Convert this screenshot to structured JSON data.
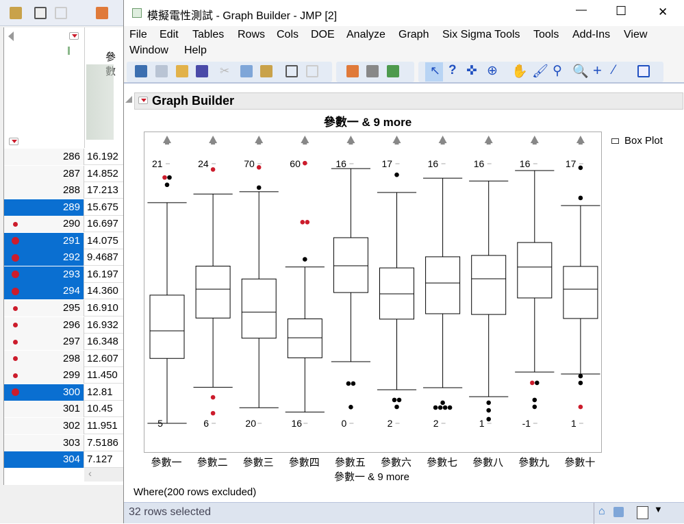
{
  "background_table": {
    "column_header": "參數",
    "rows": [
      {
        "n": "286",
        "v": "16.192",
        "sel": false,
        "marker": ""
      },
      {
        "n": "287",
        "v": "14.852",
        "sel": false,
        "marker": ""
      },
      {
        "n": "288",
        "v": "17.213",
        "sel": false,
        "marker": ""
      },
      {
        "n": "289",
        "v": "15.675",
        "sel": true,
        "marker": ""
      },
      {
        "n": "290",
        "v": "16.697",
        "sel": false,
        "marker": "small"
      },
      {
        "n": "291",
        "v": "14.075",
        "sel": true,
        "marker": "large"
      },
      {
        "n": "292",
        "v": "9.4687",
        "sel": true,
        "marker": "large"
      },
      {
        "n": "293",
        "v": "16.197",
        "sel": true,
        "marker": "large"
      },
      {
        "n": "294",
        "v": "14.360",
        "sel": true,
        "marker": "large"
      },
      {
        "n": "295",
        "v": "16.910",
        "sel": false,
        "marker": "small"
      },
      {
        "n": "296",
        "v": "16.932",
        "sel": false,
        "marker": "small"
      },
      {
        "n": "297",
        "v": "16.348",
        "sel": false,
        "marker": "small"
      },
      {
        "n": "298",
        "v": "12.607",
        "sel": false,
        "marker": "small"
      },
      {
        "n": "299",
        "v": "11.450",
        "sel": false,
        "marker": "small"
      },
      {
        "n": "300",
        "v": "12.81",
        "sel": true,
        "marker": "large"
      },
      {
        "n": "301",
        "v": "10.45",
        "sel": false,
        "marker": ""
      },
      {
        "n": "302",
        "v": "11.951",
        "sel": false,
        "marker": ""
      },
      {
        "n": "303",
        "v": "7.5186",
        "sel": false,
        "marker": ""
      },
      {
        "n": "304",
        "v": "7.127",
        "sel": true,
        "marker": ""
      }
    ]
  },
  "window": {
    "title": "模擬電性測試 - Graph Builder - JMP [2]",
    "minimize": "—",
    "maximize": "☐",
    "close": "✕"
  },
  "menu": [
    "File",
    "Edit",
    "Tables",
    "Rows",
    "Cols",
    "DOE",
    "Analyze",
    "Graph",
    "Six Sigma Tools",
    "Tools",
    "Add-Ins",
    "View",
    "Window",
    "Help"
  ],
  "graph_builder": {
    "header": "Graph Builder",
    "legend_label": "Box Plot",
    "where": "Where(200 rows excluded)"
  },
  "status": {
    "text": "32 rows selected"
  },
  "colors": {
    "selected": "#0a6fd1",
    "marker_red": "#cc1c2c",
    "accent": "#dde4ef"
  },
  "chart_data": {
    "type": "box",
    "title": "參數一 & 9 more",
    "xlabel": "參數一 & 9 more",
    "categories": [
      "參數一",
      "參數二",
      "參數三",
      "參數四",
      "參數五",
      "參數六",
      "參數七",
      "參數八",
      "參數九",
      "參數十"
    ],
    "axis_labels": [
      [
        "21",
        "5"
      ],
      [
        "24",
        "6"
      ],
      [
        "70",
        "20"
      ],
      [
        "60",
        "16"
      ],
      [
        "16",
        "0"
      ],
      [
        "17",
        "2"
      ],
      [
        "16",
        "2"
      ],
      [
        "16",
        "1"
      ],
      [
        "16",
        "-1"
      ],
      [
        "17",
        "1"
      ]
    ],
    "series": [
      {
        "ylim": [
          5,
          21
        ],
        "whisker_low": 5.0,
        "q1": 9.0,
        "median": 10.7,
        "q3": 12.9,
        "whisker_high": 18.6,
        "outliers": [
          [
            20.15,
            "red"
          ],
          [
            20.15,
            "black"
          ],
          [
            19.7,
            "black"
          ]
        ]
      },
      {
        "ylim": [
          6,
          24
        ],
        "whisker_low": 8.5,
        "q1": 13.3,
        "median": 15.3,
        "q3": 16.9,
        "whisker_high": 21.9,
        "outliers": [
          [
            23.6,
            "red"
          ],
          [
            7.8,
            "red"
          ],
          [
            6.7,
            "red"
          ]
        ]
      },
      {
        "ylim": [
          20,
          70
        ],
        "whisker_low": 23.0,
        "q1": 36.4,
        "median": 41.4,
        "q3": 47.8,
        "whisker_high": 64.6,
        "outliers": [
          [
            69.3,
            "red"
          ],
          [
            65.4,
            "black"
          ]
        ]
      },
      {
        "ylim": [
          16,
          60
        ],
        "whisker_low": 17.9,
        "q1": 27.1,
        "median": 30.5,
        "q3": 33.7,
        "whisker_high": 42.5,
        "outliers": [
          [
            60.1,
            "red"
          ],
          [
            50.1,
            "red"
          ],
          [
            50.1,
            "red"
          ],
          [
            43.8,
            "black"
          ]
        ]
      },
      {
        "ylim": [
          0,
          16
        ],
        "whisker_low": 3.8,
        "q1": 8.06,
        "median": 9.71,
        "q3": 11.44,
        "whisker_high": 15.7,
        "outliers": [
          [
            2.45,
            "black"
          ],
          [
            2.45,
            "black"
          ],
          [
            1.0,
            "black"
          ]
        ]
      },
      {
        "ylim": [
          2,
          17
        ],
        "whisker_low": 3.94,
        "q1": 8.02,
        "median": 9.48,
        "q3": 10.98,
        "whisker_high": 15.34,
        "outliers": [
          [
            16.36,
            "black"
          ],
          [
            3.35,
            "black"
          ],
          [
            3.35,
            "black"
          ],
          [
            2.95,
            "black"
          ]
        ]
      },
      {
        "ylim": [
          2,
          16
        ],
        "whisker_low": 3.92,
        "q1": 7.91,
        "median": 9.57,
        "q3": 10.98,
        "whisker_high": 15.22,
        "outliers": [
          [
            3.11,
            "black"
          ],
          [
            2.85,
            "black"
          ],
          [
            2.85,
            "black"
          ],
          [
            2.85,
            "black"
          ],
          [
            2.85,
            "black"
          ]
        ]
      },
      {
        "ylim": [
          1,
          16
        ],
        "whisker_low": 2.54,
        "q1": 7.29,
        "median": 9.35,
        "q3": 10.7,
        "whisker_high": 15.0,
        "outliers": [
          [
            2.19,
            "black"
          ],
          [
            1.75,
            "black"
          ],
          [
            1.24,
            "black"
          ]
        ]
      },
      {
        "ylim": [
          -1,
          16
        ],
        "whisker_low": 2.36,
        "q1": 7.21,
        "median": 9.23,
        "q3": 10.84,
        "whisker_high": 15.55,
        "outliers": [
          [
            1.65,
            "red"
          ],
          [
            1.65,
            "black"
          ],
          [
            0.53,
            "black"
          ],
          [
            0.08,
            "black"
          ]
        ]
      },
      {
        "ylim": [
          1,
          17
        ],
        "whisker_low": 4.04,
        "q1": 7.46,
        "median": 9.27,
        "q3": 10.67,
        "whisker_high": 14.42,
        "outliers": [
          [
            16.75,
            "black"
          ],
          [
            14.89,
            "black"
          ],
          [
            3.91,
            "black"
          ],
          [
            3.49,
            "black"
          ],
          [
            2.01,
            "red"
          ]
        ]
      }
    ]
  }
}
